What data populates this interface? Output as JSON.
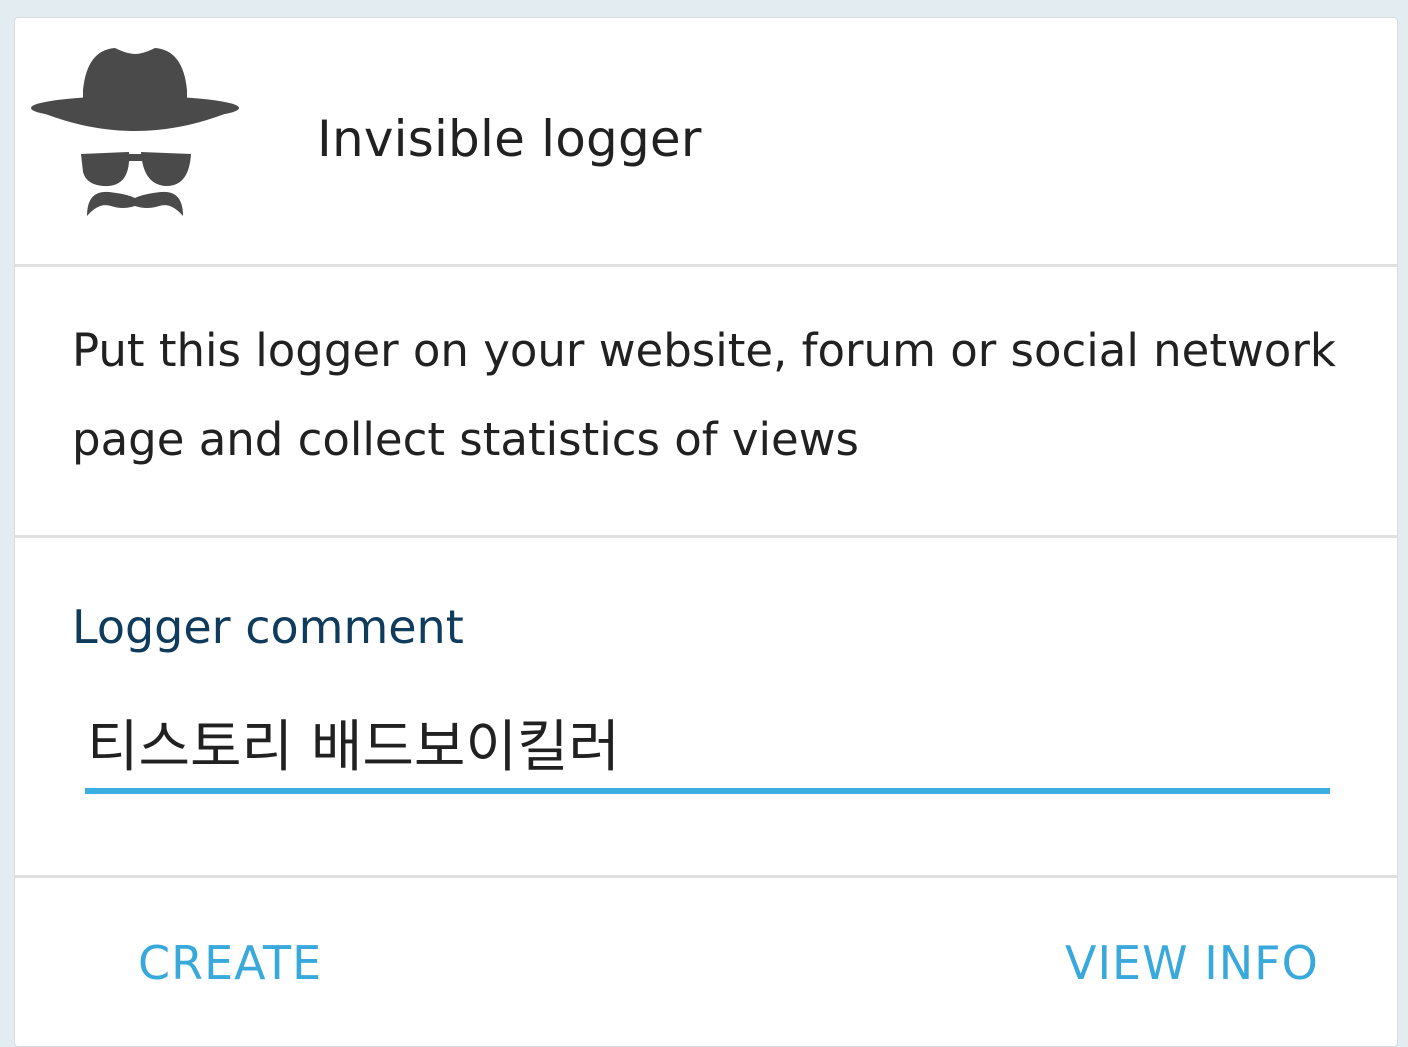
{
  "header": {
    "logo_icon": "incognito-icon",
    "title": "Invisible logger"
  },
  "description": "Put this logger on your website, forum or social network page and collect statistics of views",
  "form": {
    "label": "Logger comment",
    "value": "티스토리 배드보이킬러"
  },
  "actions": {
    "create_label": "CREATE",
    "view_info_label": "VIEW INFO"
  },
  "colors": {
    "accent": "#39a9dc",
    "label": "#0f3b5c",
    "text": "#212121",
    "icon": "#4a4a4a"
  }
}
